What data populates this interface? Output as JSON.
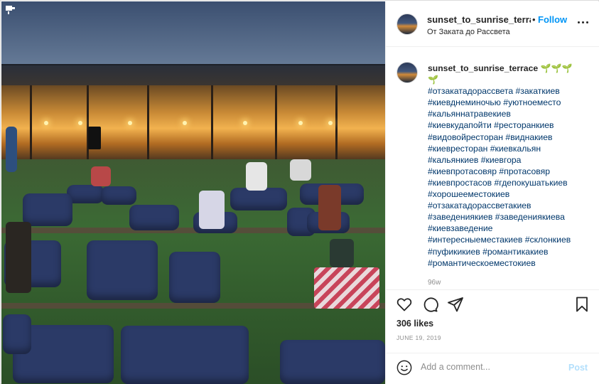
{
  "header": {
    "username": "sunset_to_sunrise_terrace",
    "separator": "•",
    "follow_label": "Follow",
    "location": "От Заката до Рассвета",
    "more_icon": "more-horizontal-icon"
  },
  "caption": {
    "username": "sunset_to_sunrise_terrace",
    "emojis": [
      "🌱",
      "🌱",
      "🌱",
      "🌱"
    ],
    "hashtags": [
      "#отзакатадорассвета #закаткиев",
      "#киевднеминочью #уютноеместо",
      "#кальяннатравекиев",
      "#киевкудапойти #ресторанкиев",
      "#видовойресторан #виднакиев",
      "#киевресторан #киевкальян",
      "#кальянкиев #киевгора",
      "#киевпротасовяр #протасовяр",
      "#киевпростасов #гдепокушатькиев",
      "#хорошееместокиев",
      "#отзакатадорассветакиев",
      "#заведениякиев #заведениякиева",
      "#киевзаведение",
      "#интересныеместакиев #склонкиев",
      "#пуфикикиев #романтикакиев",
      "#романтическоеместокиев"
    ],
    "time_ago": "96w"
  },
  "actions": {
    "like_icon": "heart-icon",
    "comment_icon": "comment-icon",
    "share_icon": "share-icon",
    "save_icon": "bookmark-icon"
  },
  "likes": "306 likes",
  "date": "JUNE 19, 2019",
  "comment_box": {
    "placeholder": "Add a comment...",
    "post_label": "Post"
  },
  "colors": {
    "accent": "#0095f6",
    "link": "#00376b",
    "post_disabled": "#b2dffc",
    "muted": "#8e8e8e"
  }
}
